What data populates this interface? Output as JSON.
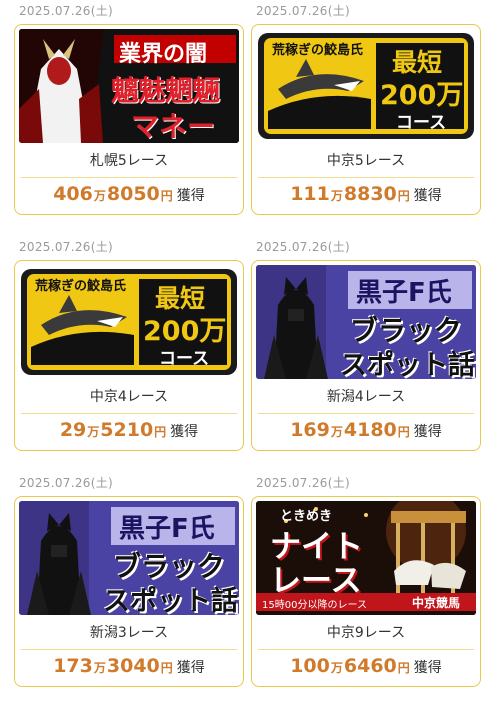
{
  "cards": [
    {
      "date": "2025.07.26(土)",
      "race": "札幌5レース",
      "amount_man": "406",
      "man_unit": "万",
      "amount_rest": "8050",
      "yen_unit": "円",
      "gain": "獲得",
      "banner": {
        "type": "demon",
        "line1": "業界の闇",
        "line2": "魑魅魍魎",
        "line3": "マネー"
      }
    },
    {
      "date": "2025.07.26(土)",
      "race": "中京5レース",
      "amount_man": "111",
      "man_unit": "万",
      "amount_rest": "8830",
      "yen_unit": "円",
      "gain": "獲得",
      "banner": {
        "type": "shark",
        "name": "荒稼ぎの鮫島氏",
        "line1": "最短",
        "line2": "200万",
        "line3": "コース"
      }
    },
    {
      "date": "2025.07.26(土)",
      "race": "中京4レース",
      "amount_man": "29",
      "man_unit": "万",
      "amount_rest": "5210",
      "yen_unit": "円",
      "gain": "獲得",
      "banner": {
        "type": "shark",
        "name": "荒稼ぎの鮫島氏",
        "line1": "最短",
        "line2": "200万",
        "line3": "コース"
      }
    },
    {
      "date": "2025.07.26(土)",
      "race": "新潟4レース",
      "amount_man": "169",
      "man_unit": "万",
      "amount_rest": "4180",
      "yen_unit": "円",
      "gain": "獲得",
      "banner": {
        "type": "kuroko",
        "line1": "黒子F氏",
        "line2": "ブラック",
        "line3": "スポット話"
      }
    },
    {
      "date": "2025.07.26(土)",
      "race": "新潟3レース",
      "amount_man": "173",
      "man_unit": "万",
      "amount_rest": "3040",
      "yen_unit": "円",
      "gain": "獲得",
      "banner": {
        "type": "kuroko",
        "line1": "黒子F氏",
        "line2": "ブラック",
        "line3": "スポット話"
      }
    },
    {
      "date": "2025.07.26(土)",
      "race": "中京9レース",
      "amount_man": "100",
      "man_unit": "万",
      "amount_rest": "6460",
      "yen_unit": "円",
      "gain": "獲得",
      "banner": {
        "type": "night",
        "line0": "ときめき",
        "line1": "ナイト",
        "line2": "レース",
        "line3": "15時00分以降のレース",
        "line4": "中京競馬"
      }
    }
  ],
  "colors": {
    "accent": "#d07a2c",
    "border": "#e9c94b",
    "date": "#9a9a9a"
  }
}
